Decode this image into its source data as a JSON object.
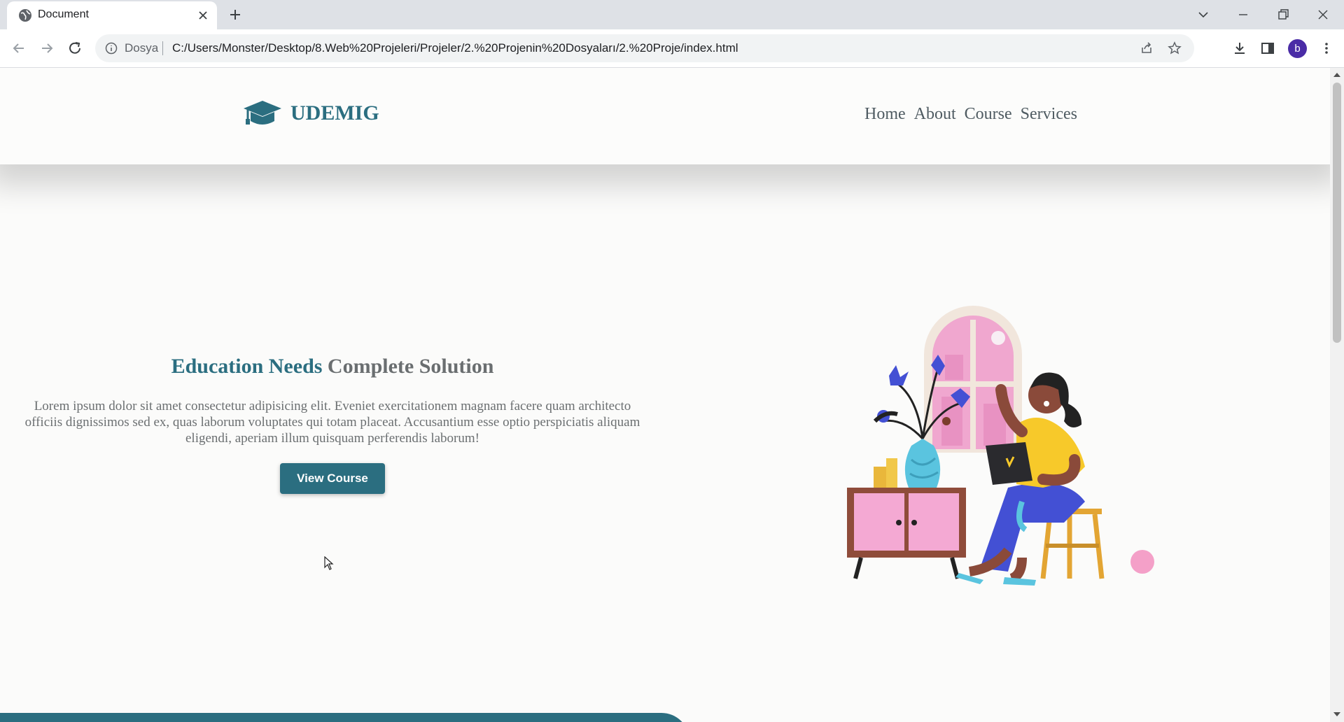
{
  "browser": {
    "tab_title": "Document",
    "omnibox_scheme": "Dosya",
    "url": "C:/Users/Monster/Desktop/8.Web%20Projeleri/Projeler/2.%20Projenin%20Dosyaları/2.%20Proje/index.html",
    "profile_initial": "b"
  },
  "site": {
    "logo_text": "UDEMIG",
    "nav": [
      "Home",
      "About",
      "Course",
      "Services"
    ]
  },
  "hero": {
    "title_part1": "Education Needs",
    "title_part2": "Complete Solution",
    "body_line1": "Lorem ipsum dolor sit amet consectetur adipisicing elit. Eveniet exercitationem magnam facere quam architecto",
    "body_line2": "officiis dignissimos sed ex, quas laborum voluptates qui totam placeat. Accusantium esse optio perspiciatis aliquam",
    "body_line3": "eligendi, aperiam illum quisquam perferendis laborum!",
    "button_label": "View Course"
  },
  "colors": {
    "brand": "#2b6e80",
    "nav_text": "#4f5b62",
    "body_text": "#6b6f71"
  }
}
